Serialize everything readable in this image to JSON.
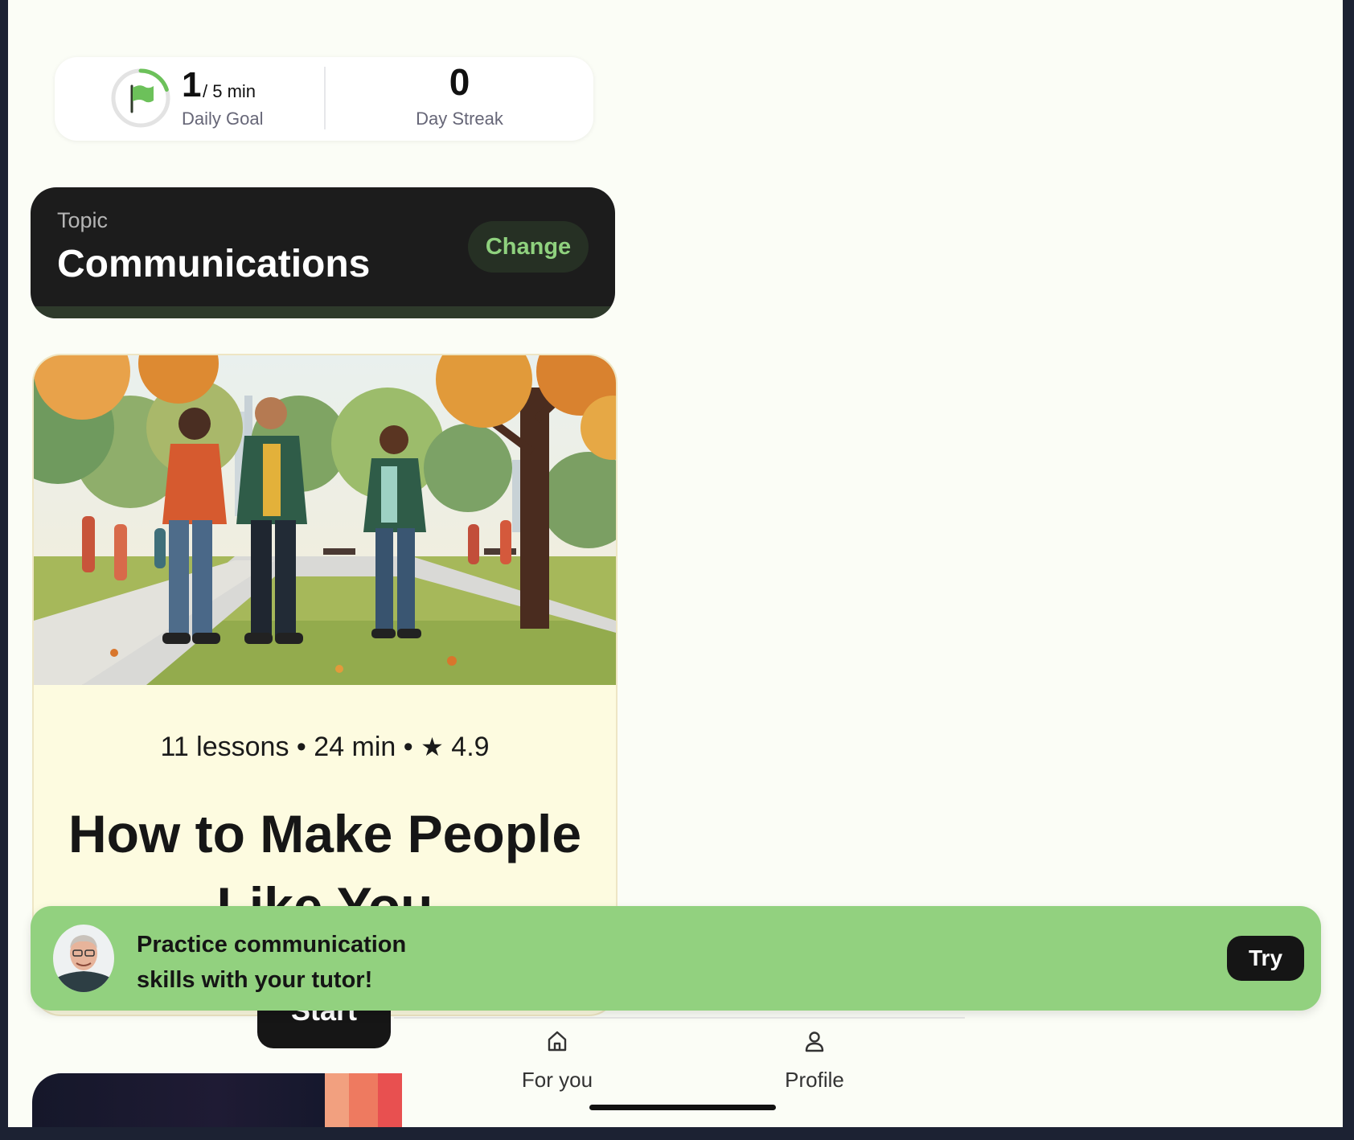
{
  "stats": {
    "goal_value": "1",
    "goal_unit": "/ 5 min",
    "goal_label": "Daily Goal",
    "goal_progress": 0.2,
    "streak_value": "0",
    "streak_label": "Day Streak"
  },
  "topic": {
    "label": "Topic",
    "title": "Communications",
    "change_label": "Change"
  },
  "course": {
    "meta_lessons": "11 lessons",
    "meta_duration": "24 min",
    "rating": "4.9",
    "title": "How to Make People Like You",
    "start_label": "Start"
  },
  "banner": {
    "line1": "Practice communication",
    "line2": "skills with your tutor!",
    "try_label": "Try"
  },
  "nav": {
    "for_you": "For you",
    "profile": "Profile"
  },
  "colors": {
    "accent_green": "#92d17f",
    "change_text": "#8fd17e",
    "dark": "#1c1c1c",
    "course_bg": "#fdfbe0"
  }
}
